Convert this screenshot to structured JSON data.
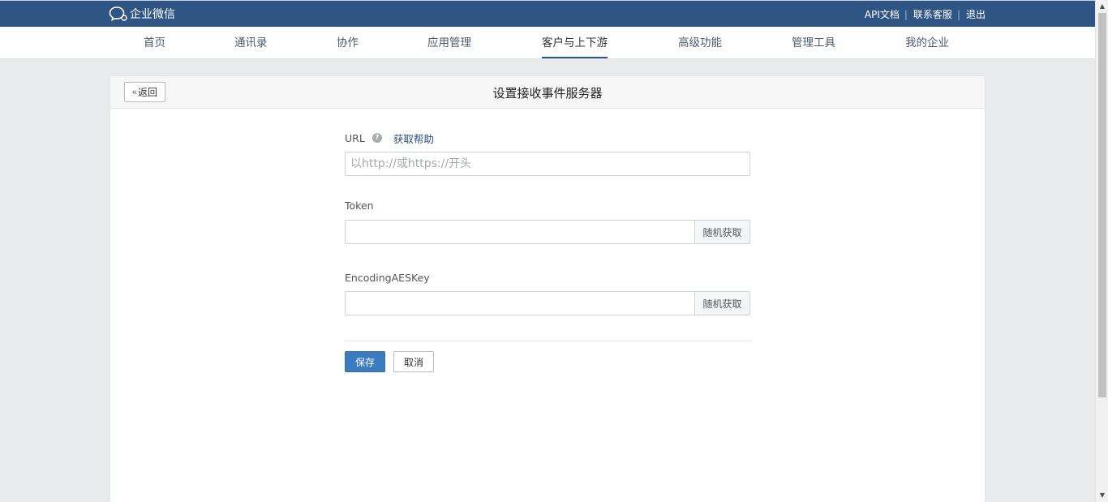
{
  "header": {
    "brand": "企业微信",
    "links": [
      {
        "label": "API文档"
      },
      {
        "label": "联系客服"
      },
      {
        "label": "退出"
      }
    ]
  },
  "nav": {
    "items": [
      {
        "label": "首页"
      },
      {
        "label": "通讯录"
      },
      {
        "label": "协作"
      },
      {
        "label": "应用管理"
      },
      {
        "label": "客户与上下游",
        "active": true
      },
      {
        "label": "高级功能"
      },
      {
        "label": "管理工具"
      },
      {
        "label": "我的企业"
      }
    ],
    "active_color": "#2f5584"
  },
  "page": {
    "back_label": "返回",
    "title": "设置接收事件服务器"
  },
  "form": {
    "url": {
      "label": "URL",
      "help_icon": "question-icon",
      "help_link": "获取帮助",
      "placeholder": "以http://或https://开头",
      "value": ""
    },
    "token": {
      "label": "Token",
      "value": "",
      "random_button": "随机获取"
    },
    "aes_key": {
      "label": "EncodingAESKey",
      "value": "",
      "random_button": "随机获取"
    },
    "save_label": "保存",
    "cancel_label": "取消"
  },
  "colors": {
    "topbar": "#2f5584",
    "primary_button": "#3b7cc1",
    "background": "#e9eaec"
  }
}
